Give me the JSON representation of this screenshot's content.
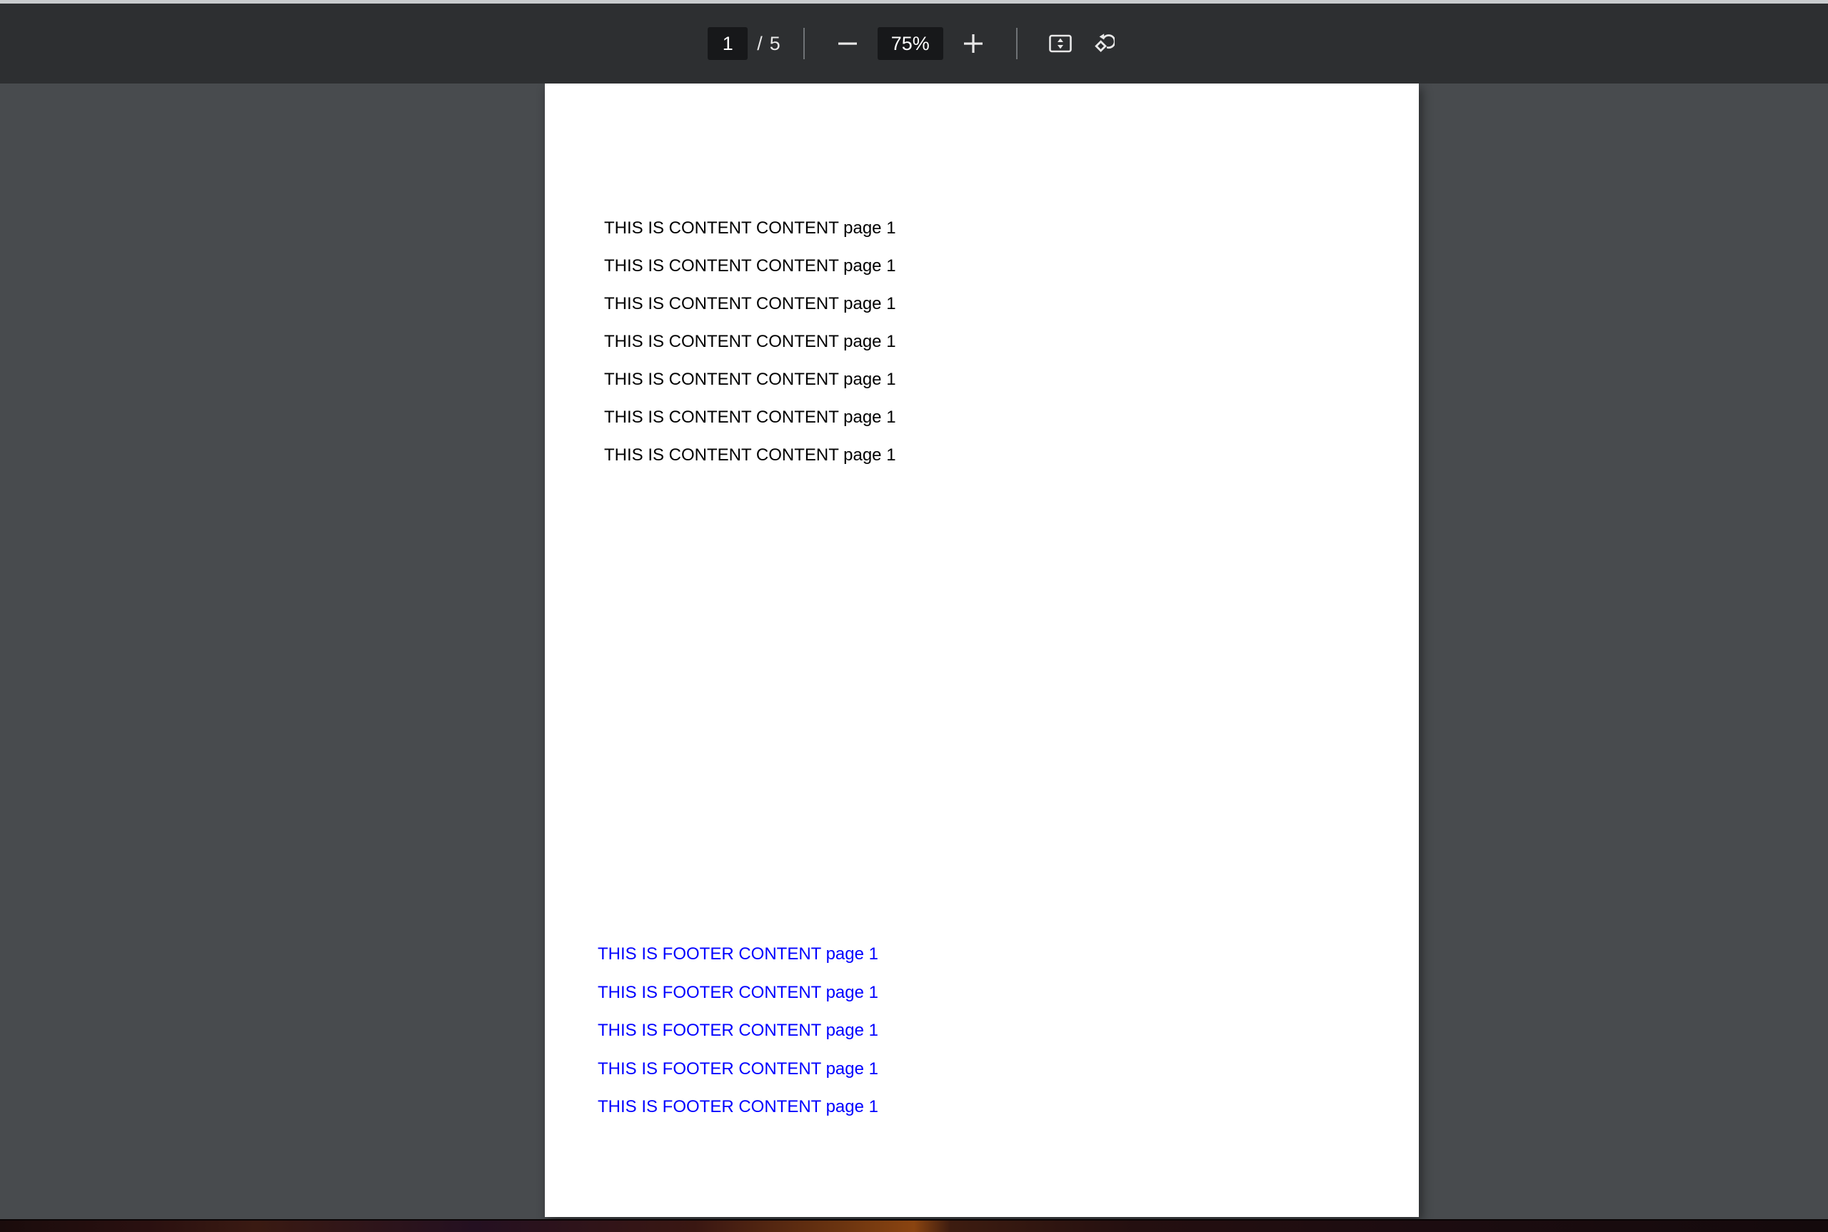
{
  "app": {
    "kind": "pdf-viewer",
    "background_color": "#484b4e",
    "toolbar_color": "#2d2f31"
  },
  "toolbar": {
    "page_number": "1",
    "page_separator": "/",
    "page_total": "5",
    "zoom_out_label": "−",
    "zoom_level": "75%",
    "zoom_in_label": "+",
    "fit_icon_name": "fit-to-page-icon",
    "rotate_icon_name": "rotate-counterclockwise-icon",
    "page_field_bg": "#17181a",
    "zoom_field_bg": "#17181a",
    "text_color": "#ffffff"
  },
  "document": {
    "page_color": "#ffffff",
    "content_color": "#000000",
    "footer_color": "#0000ff",
    "content_lines": [
      "THIS IS CONTENT CONTENT page 1",
      "THIS IS CONTENT CONTENT page 1",
      "THIS IS CONTENT CONTENT page 1",
      "THIS IS CONTENT CONTENT page 1",
      "THIS IS CONTENT CONTENT page 1",
      "THIS IS CONTENT CONTENT page 1",
      "THIS IS CONTENT CONTENT page 1"
    ],
    "footer_lines": [
      "THIS IS FOOTER CONTENT page 1",
      "THIS IS FOOTER CONTENT page 1",
      "THIS IS FOOTER CONTENT page 1",
      "THIS IS FOOTER CONTENT page 1",
      "THIS IS FOOTER CONTENT page 1"
    ]
  }
}
